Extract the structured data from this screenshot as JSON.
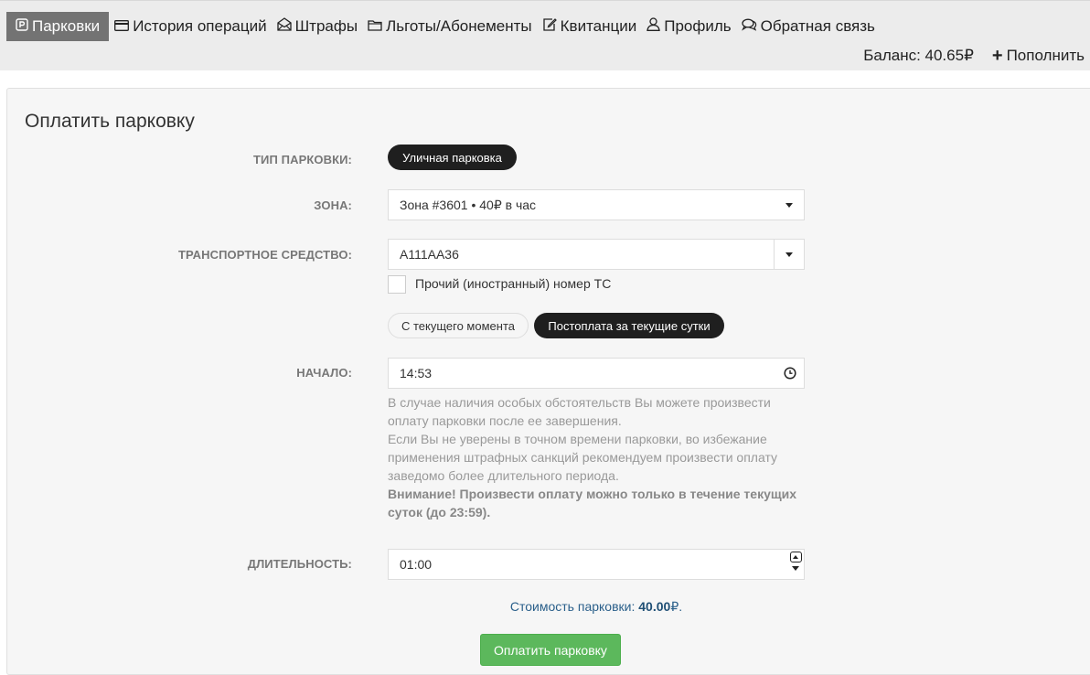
{
  "nav": {
    "items": [
      {
        "label": "Парковки",
        "icon": "parking-icon",
        "active": true
      },
      {
        "label": "История операций",
        "icon": "credit-card-icon",
        "active": false
      },
      {
        "label": "Штрафы",
        "icon": "envelope-open-icon",
        "active": false
      },
      {
        "label": "Льготы/Абонементы",
        "icon": "folder-icon",
        "active": false
      },
      {
        "label": "Квитанции",
        "icon": "edit-icon",
        "active": false
      },
      {
        "label": "Профиль",
        "icon": "user-icon",
        "active": false
      },
      {
        "label": "Обратная связь",
        "icon": "comments-icon",
        "active": false
      }
    ],
    "balance": "Баланс: 40.65₽",
    "topup": "Пополнить"
  },
  "form": {
    "title": "Оплатить парковку",
    "parking_type": {
      "label": "ТИП ПАРКОВКИ:",
      "value": "Уличная парковка"
    },
    "zone": {
      "label": "ЗОНА:",
      "value": "Зона #3601 • 40₽ в час"
    },
    "vehicle": {
      "label": "ТРАНСПОРТНОЕ СРЕДСТВО:",
      "value": "А111АА36"
    },
    "foreign_plate": {
      "label": "Прочий (иностранный) номер ТС",
      "checked": false
    },
    "mode": {
      "option_now": "С текущего момента",
      "option_postpay": "Постоплата за текущие сутки",
      "selected": "option_postpay"
    },
    "start": {
      "label": "НАЧАЛО:",
      "value": "14:53"
    },
    "help": {
      "line1": "В случае наличия особых обстоятельств Вы можете произвести оплату парковки после ее завершения.",
      "line2": "Если Вы не уверены в точном времени парковки, во избежание применения штрафных санкций рекомендуем произвести оплату заведомо более длительного периода.",
      "warning": "Внимание! Произвести оплату можно только в течение текущих суток (до 23:59)."
    },
    "duration": {
      "label": "ДЛИТЕЛЬНОСТЬ:",
      "value": "01:00"
    },
    "cost": {
      "prefix": "Стоимость парковки: ",
      "amount": "40.00",
      "suffix": "₽."
    },
    "submit": "Оплатить парковку"
  }
}
